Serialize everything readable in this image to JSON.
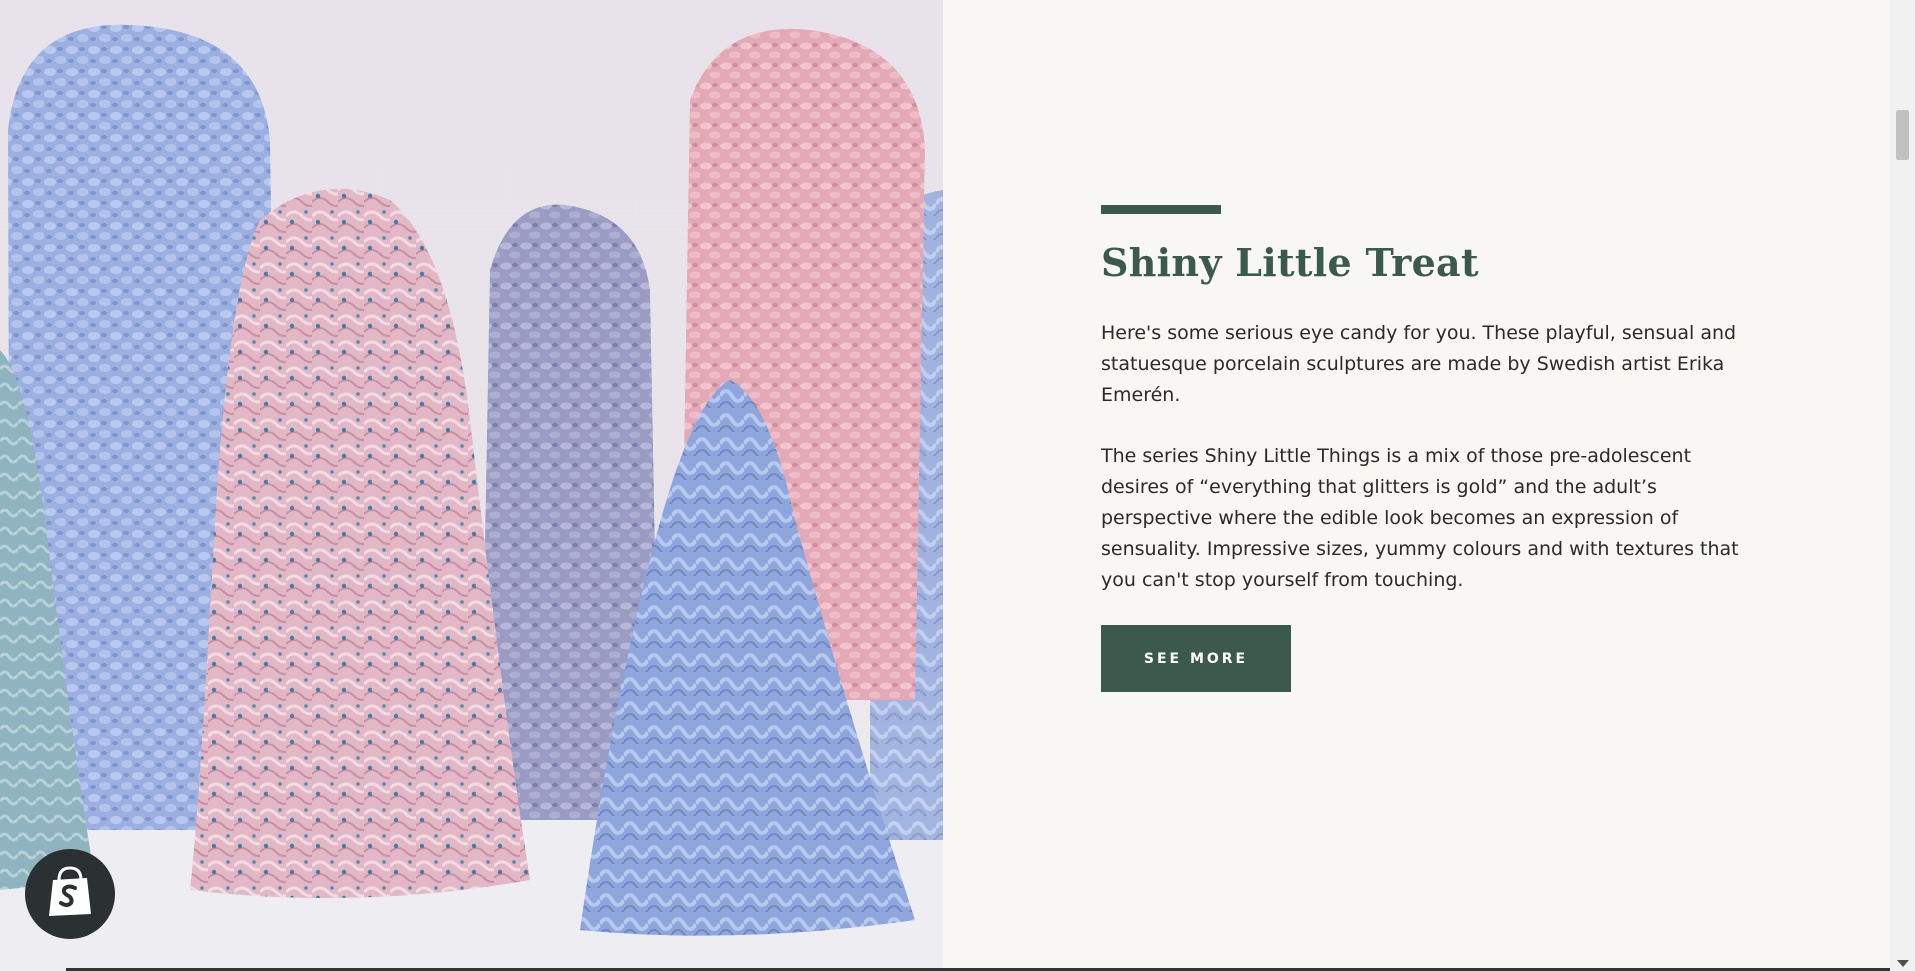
{
  "feature": {
    "title": "Shiny Little Treat",
    "paragraphs": [
      "Here's some serious eye candy for you. These playful, sensual and statuesque porcelain sculptures are made by Swedish artist Erika Emerén.",
      "The series Shiny Little Things is a mix of those pre-adolescent desires of “everything that glitters is gold” and the adult’s perspective where the edible look becomes an expression of sensuality. Impressive sizes, yummy colours and with textures that you can't stop yourself from touching."
    ],
    "button_label": "SEE MORE"
  },
  "colors": {
    "accent": "#3b5a4b",
    "background": "#f8f7f4",
    "text": "#2a2a2a",
    "badge": "#2b3033"
  },
  "icons": {
    "badge": "shopify-bag-icon",
    "scroll": "chevron-down-icon"
  }
}
